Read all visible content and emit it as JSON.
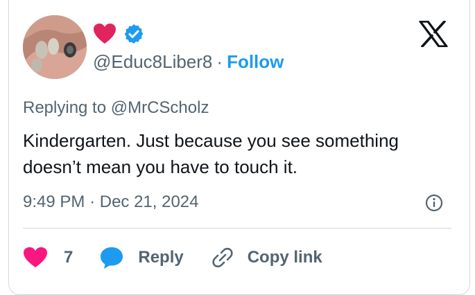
{
  "tweet": {
    "emoji": "red-heart",
    "verified_badge": "verified-badge-icon",
    "handle": "@Educ8Liber8",
    "separator": "·",
    "follow_label": "Follow",
    "replying_to": "Replying to @MrCScholz",
    "text": "Kindergarten. Just because you see something doesn’t mean you have to touch it.",
    "time": "9:49 PM",
    "date_separator": "·",
    "date": "Dec 21, 2024"
  },
  "actions": {
    "like_count": "7",
    "reply_label": "Reply",
    "copy_link_label": "Copy link"
  },
  "colors": {
    "follow_blue": "#1d9bf0",
    "like_pink": "#f91880",
    "secondary_text": "#536471",
    "primary_text": "#0f1419",
    "border": "#cfd9de"
  }
}
